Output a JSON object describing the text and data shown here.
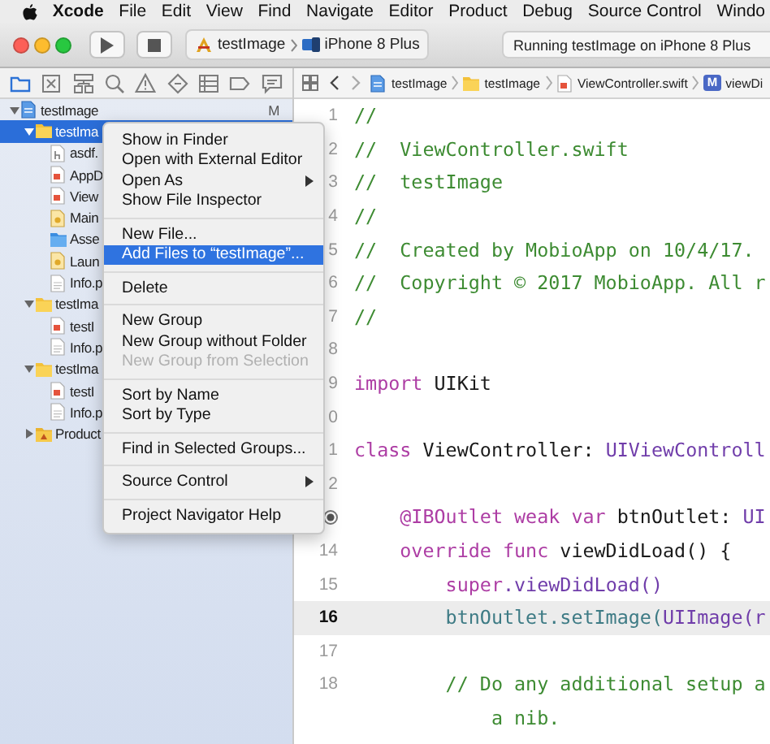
{
  "menu_bar": {
    "app": "Xcode",
    "items": [
      "File",
      "Edit",
      "View",
      "Find",
      "Navigate",
      "Editor",
      "Product",
      "Debug",
      "Source Control",
      "Windo"
    ]
  },
  "toolbar": {
    "scheme": {
      "target": "testImage",
      "device": "iPhone 8 Plus"
    },
    "status": "Running testImage on iPhone 8 Plus"
  },
  "navigator": {
    "tabs": [
      {
        "kind": "folder",
        "selected": true
      },
      {
        "kind": "source",
        "selected": false
      },
      {
        "kind": "hierarchy",
        "selected": false
      },
      {
        "kind": "search",
        "selected": false
      },
      {
        "kind": "warning",
        "selected": false
      },
      {
        "kind": "test",
        "selected": false
      },
      {
        "kind": "debug",
        "selected": false
      },
      {
        "kind": "breakpoint",
        "selected": false
      },
      {
        "kind": "report",
        "selected": false
      }
    ],
    "tree": [
      {
        "label": "testImage",
        "kind": "project",
        "badge": "M",
        "expanded": true,
        "selected": false,
        "children": [
          {
            "label": "testIma",
            "kind": "folder",
            "expanded": true,
            "selected": true,
            "children": [
              {
                "label": "asdf.",
                "kind": "header",
                "selected": false
              },
              {
                "label": "AppD",
                "kind": "swift",
                "selected": false
              },
              {
                "label": "View",
                "kind": "swift",
                "selected": false
              },
              {
                "label": "Main",
                "kind": "storyboard",
                "selected": false
              },
              {
                "label": "Asse",
                "kind": "assets",
                "selected": false
              },
              {
                "label": "Laun",
                "kind": "storyboard",
                "selected": false
              },
              {
                "label": "Info.p",
                "kind": "plist",
                "selected": false
              }
            ]
          },
          {
            "label": "testIma",
            "kind": "folder",
            "expanded": true,
            "selected": false,
            "children": [
              {
                "label": "testI",
                "kind": "swift",
                "selected": false
              },
              {
                "label": "Info.p",
                "kind": "plist",
                "selected": false
              }
            ]
          },
          {
            "label": "testIma",
            "kind": "folder",
            "expanded": true,
            "selected": false,
            "children": [
              {
                "label": "testI",
                "kind": "swift",
                "selected": false
              },
              {
                "label": "Info.p",
                "kind": "plist",
                "selected": false
              }
            ]
          },
          {
            "label": "Product",
            "kind": "products",
            "expanded": false,
            "selected": false
          }
        ]
      }
    ]
  },
  "jump_bar": [
    {
      "kind": "project",
      "label": "testImage"
    },
    {
      "kind": "folder",
      "label": "testImage"
    },
    {
      "kind": "swift",
      "label": "ViewController.swift"
    },
    {
      "kind": "method",
      "badge": "M",
      "label": "viewDi"
    }
  ],
  "context_menu": [
    {
      "kind": "item",
      "label": "Show in Finder",
      "selected": false,
      "disabled": false,
      "submenu": false
    },
    {
      "kind": "item",
      "label": "Open with External Editor",
      "selected": false,
      "disabled": false,
      "submenu": false
    },
    {
      "kind": "item",
      "label": "Open As",
      "selected": false,
      "disabled": false,
      "submenu": true
    },
    {
      "kind": "item",
      "label": "Show File Inspector",
      "selected": false,
      "disabled": false,
      "submenu": false
    },
    {
      "kind": "separator"
    },
    {
      "kind": "item",
      "label": "New File...",
      "selected": false,
      "disabled": false,
      "submenu": false
    },
    {
      "kind": "item",
      "label": "Add Files to “testImage”...",
      "selected": true,
      "disabled": false,
      "submenu": false
    },
    {
      "kind": "separator"
    },
    {
      "kind": "item",
      "label": "Delete",
      "selected": false,
      "disabled": false,
      "submenu": false
    },
    {
      "kind": "separator"
    },
    {
      "kind": "item",
      "label": "New Group",
      "selected": false,
      "disabled": false,
      "submenu": false
    },
    {
      "kind": "item",
      "label": "New Group without Folder",
      "selected": false,
      "disabled": false,
      "submenu": false
    },
    {
      "kind": "item",
      "label": "New Group from Selection",
      "selected": false,
      "disabled": true,
      "submenu": false
    },
    {
      "kind": "separator"
    },
    {
      "kind": "item",
      "label": "Sort by Name",
      "selected": false,
      "disabled": false,
      "submenu": false
    },
    {
      "kind": "item",
      "label": "Sort by Type",
      "selected": false,
      "disabled": false,
      "submenu": false
    },
    {
      "kind": "separator"
    },
    {
      "kind": "item",
      "label": "Find in Selected Groups...",
      "selected": false,
      "disabled": false,
      "submenu": false
    },
    {
      "kind": "separator"
    },
    {
      "kind": "item",
      "label": "Source Control",
      "selected": false,
      "disabled": false,
      "submenu": true
    },
    {
      "kind": "separator"
    },
    {
      "kind": "item",
      "label": "Project Navigator Help",
      "selected": false,
      "disabled": false,
      "submenu": false
    }
  ],
  "editor": {
    "lines": [
      {
        "number": "1",
        "current": false,
        "tokens": [
          {
            "text": "//",
            "kind": "comment"
          }
        ]
      },
      {
        "number": "2",
        "current": false,
        "tokens": [
          {
            "text": "//  ViewController.swift",
            "kind": "comment"
          }
        ]
      },
      {
        "number": "3",
        "current": false,
        "tokens": [
          {
            "text": "//  testImage",
            "kind": "comment"
          }
        ]
      },
      {
        "number": "4",
        "current": false,
        "tokens": [
          {
            "text": "//",
            "kind": "comment"
          }
        ]
      },
      {
        "number": "5",
        "current": false,
        "tokens": [
          {
            "text": "//  Created by MobioApp on 10/4/17.",
            "kind": "comment"
          }
        ]
      },
      {
        "number": "6",
        "current": false,
        "tokens": [
          {
            "text": "//  Copyright © 2017 MobioApp. All r",
            "kind": "comment"
          }
        ]
      },
      {
        "number": "7",
        "current": false,
        "tokens": [
          {
            "text": "//",
            "kind": "comment"
          }
        ]
      },
      {
        "number": "8",
        "current": false
      },
      {
        "number": "9",
        "current": false,
        "tokens": [
          {
            "text": "import",
            "kind": "keyword"
          },
          {
            "text": " UIKit",
            "kind": "plain"
          }
        ]
      },
      {
        "number": "0",
        "current": false
      },
      {
        "number": "1",
        "current": false,
        "tokens": [
          {
            "text": "class",
            "kind": "keyword"
          },
          {
            "text": " ViewController: ",
            "kind": "plain"
          },
          {
            "text": "UIViewControll",
            "kind": "type"
          }
        ]
      },
      {
        "number": "2",
        "current": false
      },
      {
        "outlet_connected": true,
        "current": false,
        "tokens": [
          {
            "text": "    @IBOutlet weak var",
            "kind": "keyword"
          },
          {
            "text": " btnOutlet: ",
            "kind": "plain"
          },
          {
            "text": "UI",
            "kind": "type"
          }
        ]
      },
      {
        "number": "14",
        "current": false,
        "tokens": [
          {
            "text": "    override func",
            "kind": "keyword"
          },
          {
            "text": " viewDidLoad() {",
            "kind": "plain"
          }
        ]
      },
      {
        "number": "15",
        "current": false,
        "tokens": [
          {
            "text": "        super",
            "kind": "keyword"
          },
          {
            "text": ".viewDidLoad()",
            "kind": "type"
          }
        ]
      },
      {
        "number": "16",
        "current": true,
        "tokens": [
          {
            "text": "        btnOutlet",
            "kind": "project"
          },
          {
            "text": ".setImage(",
            "kind": "project"
          },
          {
            "text": "UIImage(r",
            "kind": "type"
          }
        ]
      },
      {
        "number": "17",
        "current": false
      },
      {
        "number": "18",
        "current": false,
        "tokens": [
          {
            "text": "        // Do any additional setup a",
            "kind": "comment"
          }
        ]
      },
      {
        "current": false,
        "tokens": [
          {
            "text": "            a nib.",
            "kind": "comment"
          }
        ]
      }
    ]
  }
}
